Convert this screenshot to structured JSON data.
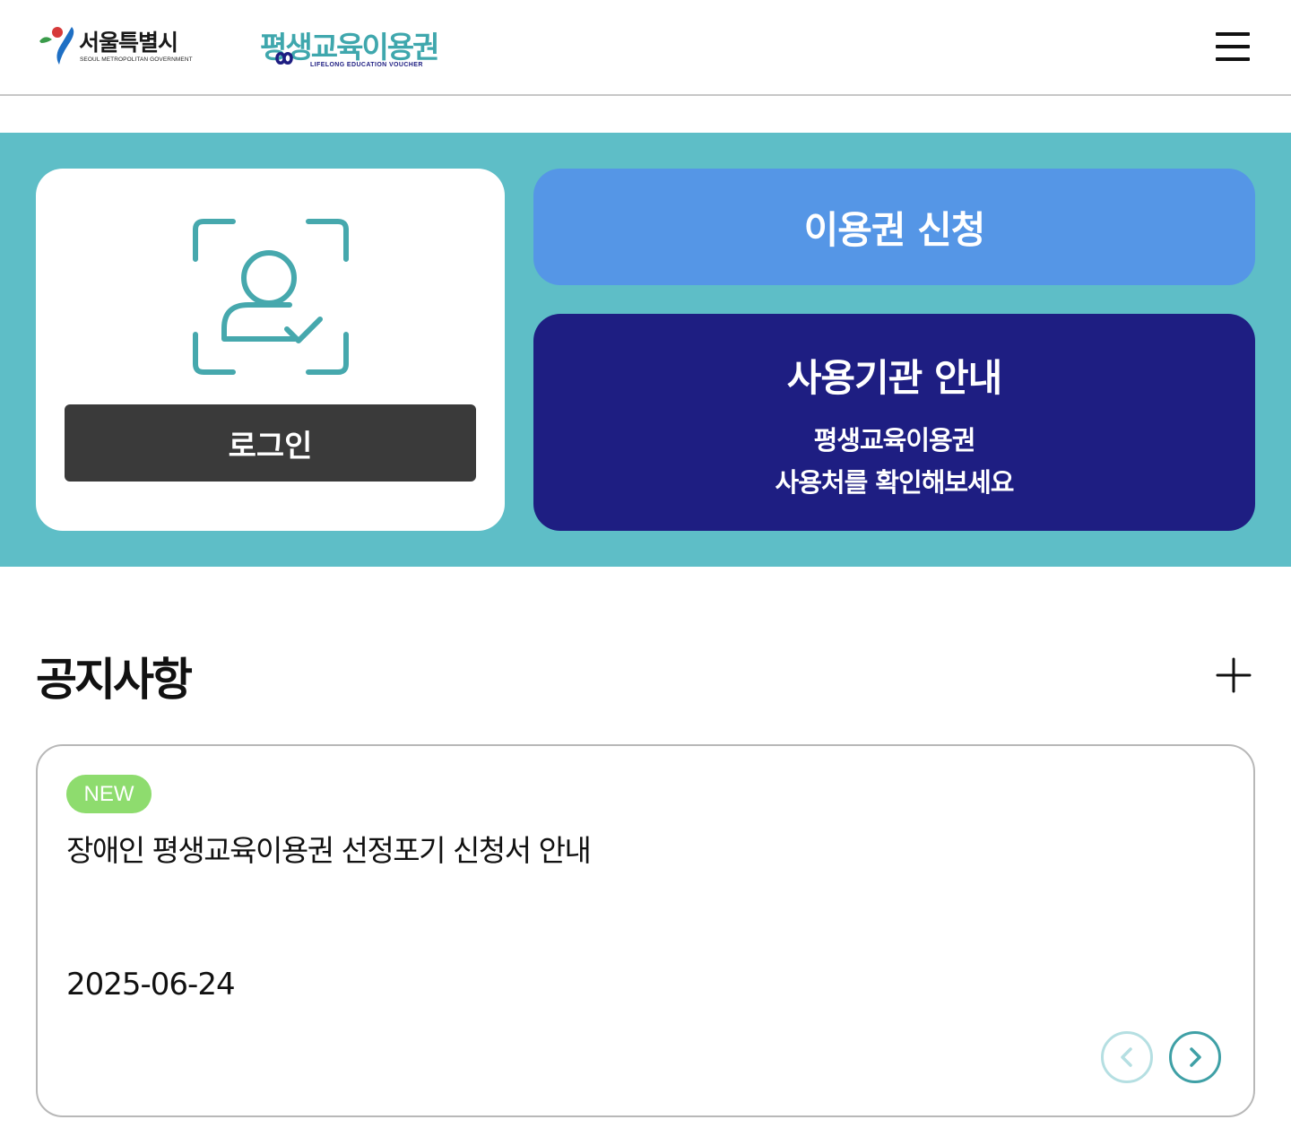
{
  "header": {
    "seoul_logo_text": "서울특별시",
    "seoul_logo_sub": "SEOUL METROPOLITAN GOVERNMENT",
    "voucher_logo_text": "평생교육이용권",
    "voucher_logo_sub": "LIFELONG EDUCATION VOUCHER",
    "menu_icon": "hamburger-menu-icon"
  },
  "hero": {
    "login_icon": "face-id-user-icon",
    "login_label": "로그인",
    "apply_label": "이용권 신청",
    "guide_title": "사용기관 안내",
    "guide_sub_line1": "평생교육이용권",
    "guide_sub_line2": "사용처를 확인해보세요"
  },
  "notice": {
    "section_title": "공지사항",
    "more_icon": "plus-icon",
    "items": [
      {
        "badge": "NEW",
        "title": "장애인 평생교육이용권 선정포기 신청서 안내",
        "date": "2025-06-24"
      }
    ],
    "prev_icon": "chevron-left-icon",
    "next_icon": "chevron-right-icon"
  },
  "colors": {
    "hero_bg": "#5ebec7",
    "apply_bg": "#5596e6",
    "guide_bg": "#1e1e82",
    "login_btn_bg": "#3a3a3a",
    "new_badge": "#8edc6e",
    "teal_accent": "#3fa7ad"
  }
}
